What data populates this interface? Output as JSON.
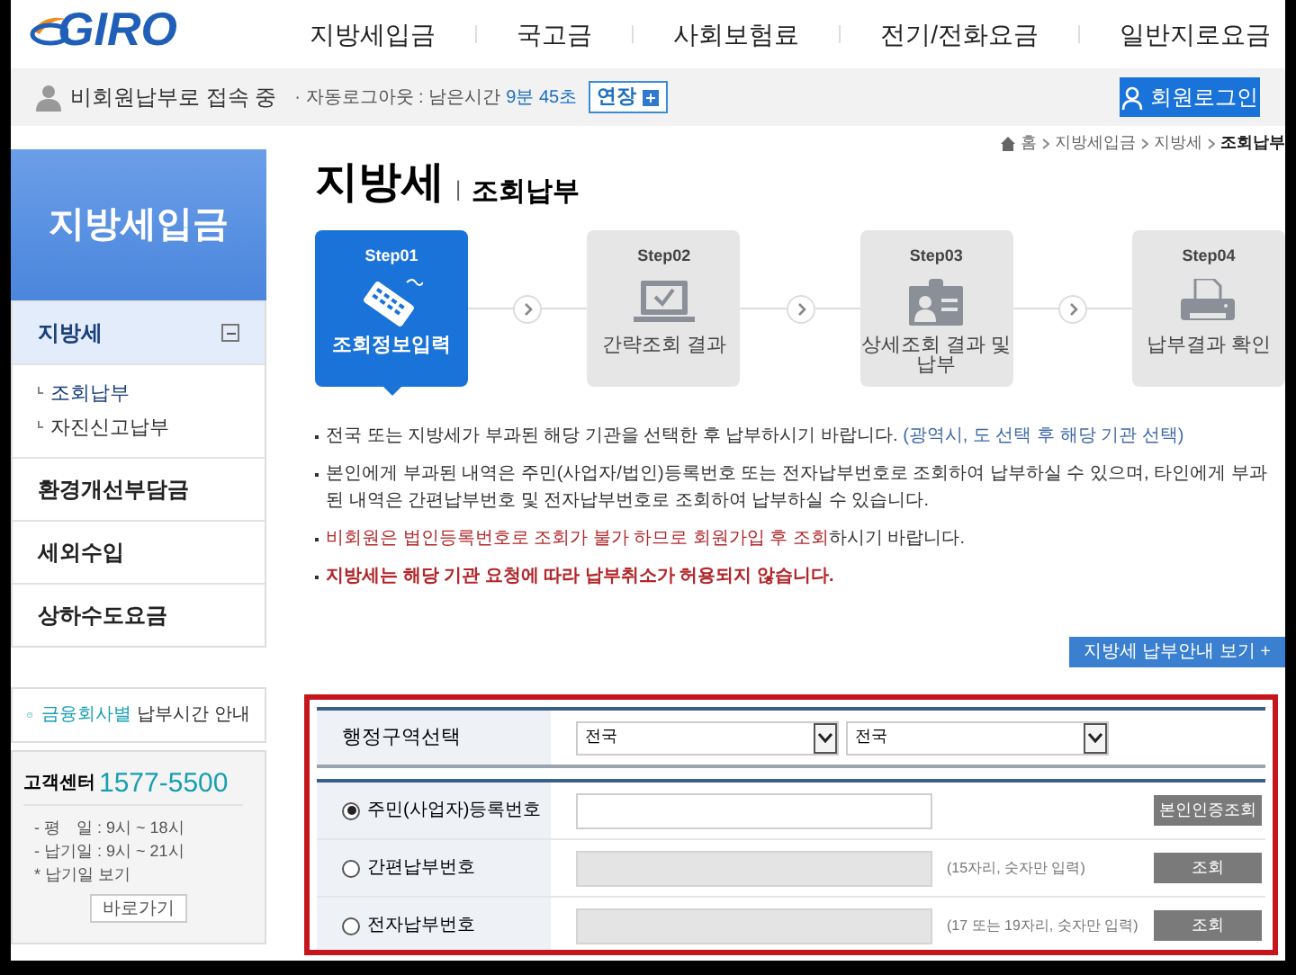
{
  "header": {
    "logo": "GIRO",
    "nav": [
      "지방세입금",
      "국고금",
      "사회보험료",
      "전기/전화요금",
      "일반지로요금"
    ]
  },
  "status_bar": {
    "user": "비회원납부로 접속 중",
    "logout_label": "· 자동로그아웃 : 남은시간",
    "remaining": "9분 45초",
    "extend": "연장",
    "login": "회원로그인"
  },
  "sidebar": {
    "title": "지방세입금",
    "items": [
      {
        "label": "지방세",
        "expanded": true,
        "selected": true,
        "children": [
          {
            "label": "조회납부",
            "selected": true
          },
          {
            "label": "자진신고납부",
            "selected": false
          }
        ]
      },
      {
        "label": "환경개선부담금",
        "expanded": false,
        "selected": false
      },
      {
        "label": "세외수입",
        "expanded": false,
        "selected": false
      },
      {
        "label": "상하수도요금",
        "expanded": false,
        "selected": false
      }
    ],
    "hours_link": {
      "highlight": "금융회사별",
      "rest": "납부시간 안내"
    },
    "contact": {
      "label": "고객센터",
      "phone": "1577-5500",
      "lines": [
        "- 평　일 : 9시 ~ 18시",
        "- 납기일 : 9시 ~ 21시",
        "* 납기일 보기"
      ],
      "button": "바로가기"
    }
  },
  "breadcrumb": [
    "홈",
    "지방세입금",
    "지방세",
    "조회납부"
  ],
  "page_title": {
    "main": "지방세",
    "separator": "|",
    "sub": "조회납부"
  },
  "steps": [
    {
      "label": "Step01",
      "title": "조회정보입력",
      "selected": true
    },
    {
      "label": "Step02",
      "title": "간략조회 결과",
      "selected": false
    },
    {
      "label": "Step03",
      "title": "상세조회 결과 및 납부",
      "selected": false
    },
    {
      "label": "Step04",
      "title": "납부결과 확인",
      "selected": false
    }
  ],
  "notes": [
    {
      "parts": [
        {
          "text": "전국 또는 지방세가 부과된 해당 기관을 선택한 후 납부하시기 바랍니다. ",
          "kind": "plain"
        },
        {
          "text": "(광역시, 도 선택 후 해당 기관 선택)",
          "kind": "link"
        }
      ]
    },
    {
      "parts": [
        {
          "text": "본인에게 부과된 내역은 주민(사업자/법인)등록번호 또는 전자납부번호로 조회하여 납부하실 수 있으며, 타인에게 부과된 내역은 간편납부번호 및 전자납부번호로 조회하여 납부하실 수 있습니다.",
          "kind": "plain"
        }
      ]
    },
    {
      "parts": [
        {
          "text": "비회원은 법인등록번호로 조회가 불가 하므로 회원가입 후 조회",
          "kind": "warning"
        },
        {
          "text": "하시기 바랍니다.",
          "kind": "plain"
        }
      ]
    },
    {
      "parts": [
        {
          "text": "지방세는 해당 기관 요청에 따라 납부취소가 허용되지 않습니다.",
          "kind": "alert"
        }
      ]
    }
  ],
  "guide_button": "지방세 납부안내 보기 +",
  "form": {
    "region_label": "행정구역선택",
    "region_selects": [
      "전국",
      "전국"
    ],
    "rows": [
      {
        "label": "주민(사업자)등록번호",
        "selected": true,
        "disabled": false,
        "button": "본인인증조회"
      },
      {
        "label": "간편납부번호",
        "selected": false,
        "disabled": true,
        "hint": "(15자리, 숫자만 입력)",
        "button": "조회"
      },
      {
        "label": "전자납부번호",
        "selected": false,
        "disabled": true,
        "hint": "(17 또는 19자리, 숫자만 입력)",
        "button": "조회"
      }
    ]
  }
}
